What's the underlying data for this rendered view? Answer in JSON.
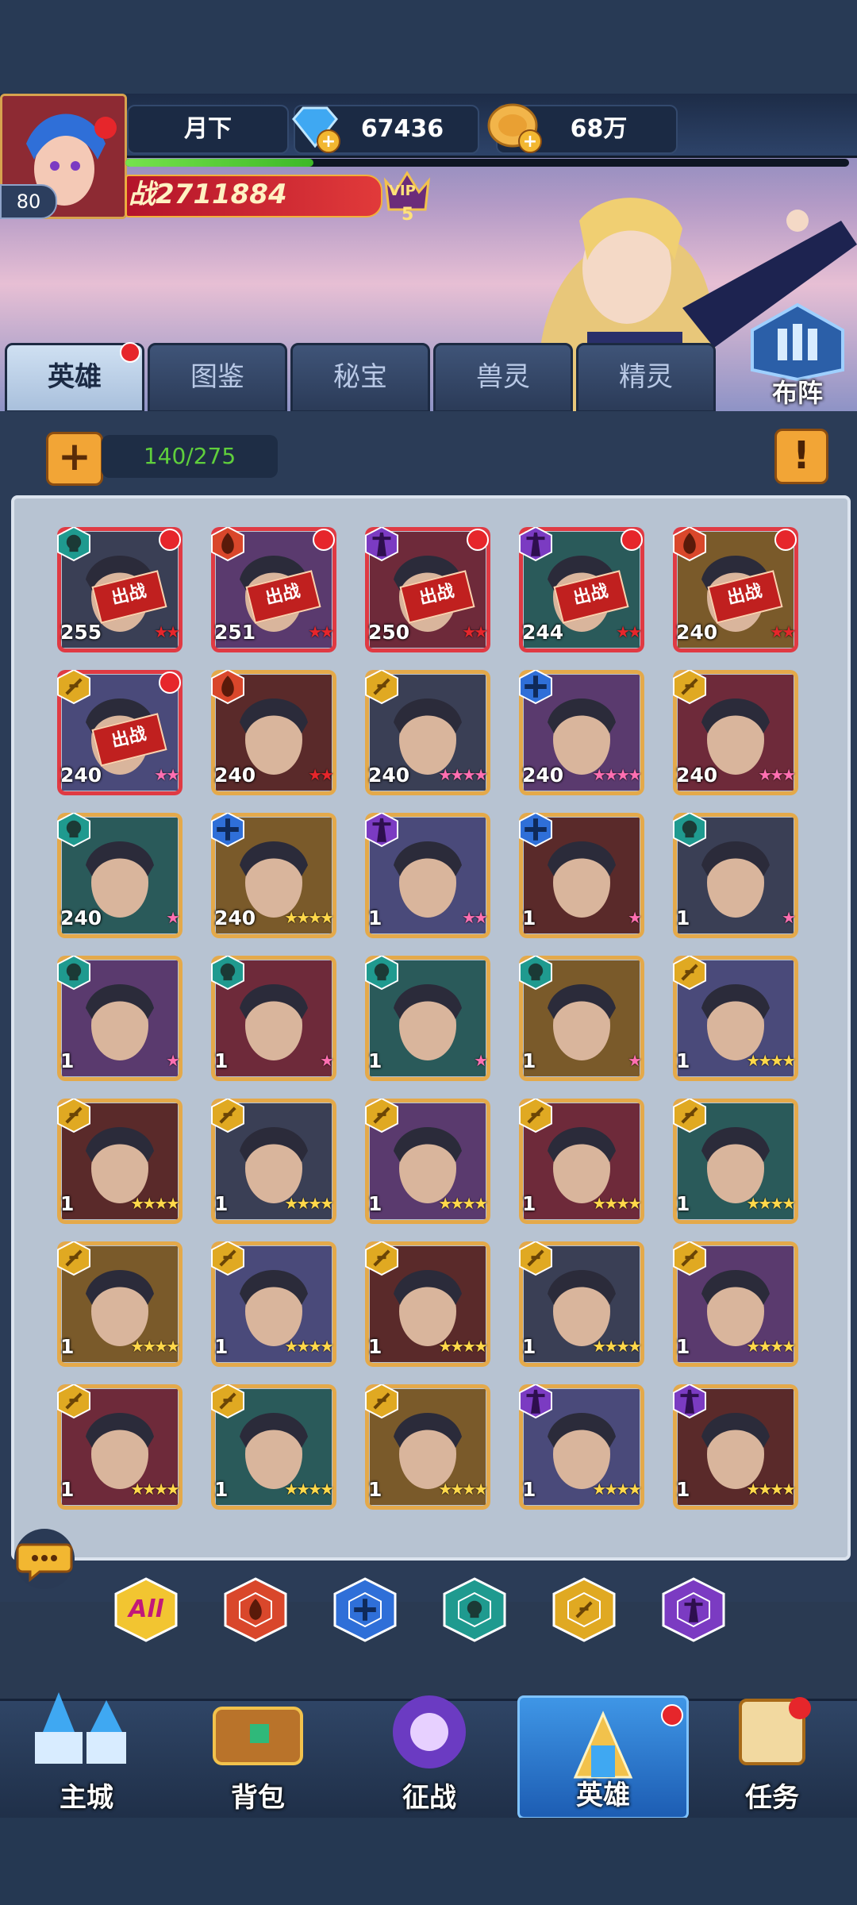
{
  "player": {
    "name": "月下",
    "level": "80",
    "gems": "67436",
    "gold": "68万",
    "power": "战2711884",
    "vip": "VIP",
    "vip_level": "5",
    "xp_progress": 0.26
  },
  "tabs": [
    {
      "label": "英雄",
      "active": true,
      "badge": true
    },
    {
      "label": "图鉴",
      "active": false
    },
    {
      "label": "秘宝",
      "active": false
    },
    {
      "label": "兽灵",
      "active": false
    },
    {
      "label": "精灵",
      "active": false
    }
  ],
  "formation_label": "布阵",
  "roster": {
    "plus": "+",
    "count": "140/275",
    "info": "!"
  },
  "deployed_label": "出战",
  "heroes": [
    {
      "level": "255",
      "faction": "undead",
      "deployed": true,
      "badge": true,
      "stars": 2,
      "star_color": "red"
    },
    {
      "level": "251",
      "faction": "fire",
      "deployed": true,
      "badge": true,
      "stars": 2,
      "star_color": "red"
    },
    {
      "level": "250",
      "faction": "dark",
      "deployed": true,
      "badge": true,
      "stars": 2,
      "star_color": "red"
    },
    {
      "level": "244",
      "faction": "dark",
      "deployed": true,
      "badge": true,
      "stars": 2,
      "star_color": "red"
    },
    {
      "level": "240",
      "faction": "fire",
      "deployed": true,
      "badge": true,
      "stars": 2,
      "star_color": "red"
    },
    {
      "level": "240",
      "faction": "light",
      "deployed": true,
      "badge": true,
      "stars": 2,
      "star_color": "pink"
    },
    {
      "level": "240",
      "faction": "fire",
      "deployed": false,
      "badge": false,
      "stars": 2,
      "star_color": "red"
    },
    {
      "level": "240",
      "faction": "light",
      "deployed": false,
      "badge": false,
      "stars": 4,
      "star_color": "pink"
    },
    {
      "level": "240",
      "faction": "holy",
      "deployed": false,
      "badge": false,
      "stars": 4,
      "star_color": "pink"
    },
    {
      "level": "240",
      "faction": "light",
      "deployed": false,
      "badge": false,
      "stars": 3,
      "star_color": "pink"
    },
    {
      "level": "240",
      "faction": "undead",
      "deployed": false,
      "badge": false,
      "stars": 1,
      "star_color": "pink"
    },
    {
      "level": "240",
      "faction": "holy",
      "deployed": false,
      "badge": false,
      "stars": 4,
      "star_color": "gold"
    },
    {
      "level": "1",
      "faction": "dark",
      "deployed": false,
      "badge": false,
      "stars": 2,
      "star_color": "pink"
    },
    {
      "level": "1",
      "faction": "holy",
      "deployed": false,
      "badge": false,
      "stars": 1,
      "star_color": "pink"
    },
    {
      "level": "1",
      "faction": "undead",
      "deployed": false,
      "badge": false,
      "stars": 1,
      "star_color": "pink"
    },
    {
      "level": "1",
      "faction": "undead",
      "deployed": false,
      "badge": false,
      "stars": 1,
      "star_color": "pink"
    },
    {
      "level": "1",
      "faction": "undead",
      "deployed": false,
      "badge": false,
      "stars": 1,
      "star_color": "pink"
    },
    {
      "level": "1",
      "faction": "undead",
      "deployed": false,
      "badge": false,
      "stars": 1,
      "star_color": "pink"
    },
    {
      "level": "1",
      "faction": "undead",
      "deployed": false,
      "badge": false,
      "stars": 1,
      "star_color": "pink"
    },
    {
      "level": "1",
      "faction": "light",
      "deployed": false,
      "badge": false,
      "stars": 4,
      "star_color": "gold"
    },
    {
      "level": "1",
      "faction": "light",
      "deployed": false,
      "badge": false,
      "stars": 4,
      "star_color": "gold"
    },
    {
      "level": "1",
      "faction": "light",
      "deployed": false,
      "badge": false,
      "stars": 4,
      "star_color": "gold"
    },
    {
      "level": "1",
      "faction": "light",
      "deployed": false,
      "badge": false,
      "stars": 4,
      "star_color": "gold"
    },
    {
      "level": "1",
      "faction": "light",
      "deployed": false,
      "badge": false,
      "stars": 4,
      "star_color": "gold"
    },
    {
      "level": "1",
      "faction": "light",
      "deployed": false,
      "badge": false,
      "stars": 4,
      "star_color": "gold"
    },
    {
      "level": "1",
      "faction": "light",
      "deployed": false,
      "badge": false,
      "stars": 4,
      "star_color": "gold"
    },
    {
      "level": "1",
      "faction": "light",
      "deployed": false,
      "badge": false,
      "stars": 4,
      "star_color": "gold"
    },
    {
      "level": "1",
      "faction": "light",
      "deployed": false,
      "badge": false,
      "stars": 4,
      "star_color": "gold"
    },
    {
      "level": "1",
      "faction": "light",
      "deployed": false,
      "badge": false,
      "stars": 4,
      "star_color": "gold"
    },
    {
      "level": "1",
      "faction": "light",
      "deployed": false,
      "badge": false,
      "stars": 4,
      "star_color": "gold"
    },
    {
      "level": "1",
      "faction": "light",
      "deployed": false,
      "badge": false,
      "stars": 4,
      "star_color": "gold"
    },
    {
      "level": "1",
      "faction": "light",
      "deployed": false,
      "badge": false,
      "stars": 4,
      "star_color": "gold"
    },
    {
      "level": "1",
      "faction": "light",
      "deployed": false,
      "badge": false,
      "stars": 4,
      "star_color": "gold"
    },
    {
      "level": "1",
      "faction": "dark",
      "deployed": false,
      "badge": false,
      "stars": 4,
      "star_color": "gold"
    },
    {
      "level": "1",
      "faction": "dark",
      "deployed": false,
      "badge": false,
      "stars": 4,
      "star_color": "gold"
    }
  ],
  "filters": [
    {
      "label": "All",
      "name": "all",
      "color": "#f2c531"
    },
    {
      "label": "",
      "name": "fire",
      "color": "#d9472b"
    },
    {
      "label": "",
      "name": "holy",
      "color": "#2f6fd8"
    },
    {
      "label": "",
      "name": "undead",
      "color": "#1f9a8f"
    },
    {
      "label": "",
      "name": "light",
      "color": "#e0a922"
    },
    {
      "label": "",
      "name": "dark",
      "color": "#7b3bc2"
    }
  ],
  "faction_colors": {
    "undead": "#1f9a8f",
    "fire": "#d9472b",
    "dark": "#7b3bc2",
    "light": "#e0a922",
    "holy": "#2f6fd8"
  },
  "nav": [
    {
      "label": "主城",
      "name": "main-city",
      "active": false
    },
    {
      "label": "背包",
      "name": "backpack",
      "active": false
    },
    {
      "label": "征战",
      "name": "campaign",
      "active": false
    },
    {
      "label": "英雄",
      "name": "heroes",
      "active": true,
      "badge": true
    },
    {
      "label": "任务",
      "name": "quests",
      "active": false
    }
  ]
}
